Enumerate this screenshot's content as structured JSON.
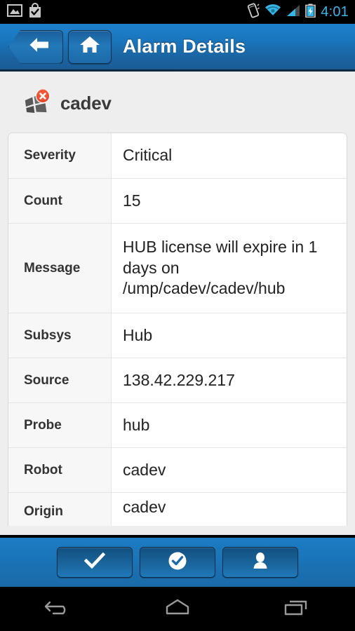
{
  "statusbar": {
    "time": "4:01",
    "left_icons": [
      {
        "name": "gallery-image-icon"
      },
      {
        "name": "play-store-bag-check-icon"
      }
    ],
    "right_icons": [
      {
        "name": "vibrate-mode-icon"
      },
      {
        "name": "wifi-signal-icon"
      },
      {
        "name": "cellular-signal-icon"
      },
      {
        "name": "battery-charging-icon"
      }
    ],
    "colors": {
      "time": "#3cb4e5",
      "background": "#000000",
      "accent": "#33b5e5"
    }
  },
  "header": {
    "title": "Alarm Details",
    "back_icon": "arrow-left-icon",
    "home_icon": "home-icon",
    "colors": {
      "gradient_top": "#1d82cc",
      "gradient_bottom": "#1a5c95",
      "border": "#0d2a45"
    }
  },
  "device": {
    "name": "cadev",
    "icon": "windows-device-icon",
    "status_badge": "error-x-badge",
    "badge_color": "#e8472a"
  },
  "details": {
    "rows": [
      {
        "label": "Severity",
        "value": "Critical"
      },
      {
        "label": "Count",
        "value": "15"
      },
      {
        "label": "Message",
        "value": "HUB license will expire in 1 days on /ump/cadev/cadev/hub"
      },
      {
        "label": "Subsys",
        "value": "Hub"
      },
      {
        "label": "Source",
        "value": "138.42.229.217"
      },
      {
        "label": "Probe",
        "value": "hub"
      },
      {
        "label": "Robot",
        "value": "cadev"
      },
      {
        "label": "Origin",
        "value": "cadev"
      }
    ]
  },
  "actionbar": {
    "buttons": [
      {
        "name": "acknowledge-button",
        "icon": "check-icon"
      },
      {
        "name": "close-alarm-button",
        "icon": "check-circle-icon"
      },
      {
        "name": "assign-button",
        "icon": "person-icon"
      }
    ],
    "colors": {
      "gradient_top": "#1d7cc4",
      "gradient_bottom": "#1b6aa8"
    }
  },
  "navbar": {
    "buttons": [
      {
        "name": "nav-back-button",
        "icon": "back-arrow-icon"
      },
      {
        "name": "nav-home-button",
        "icon": "home-pentagon-icon"
      },
      {
        "name": "nav-recents-button",
        "icon": "recents-icon"
      }
    ]
  }
}
